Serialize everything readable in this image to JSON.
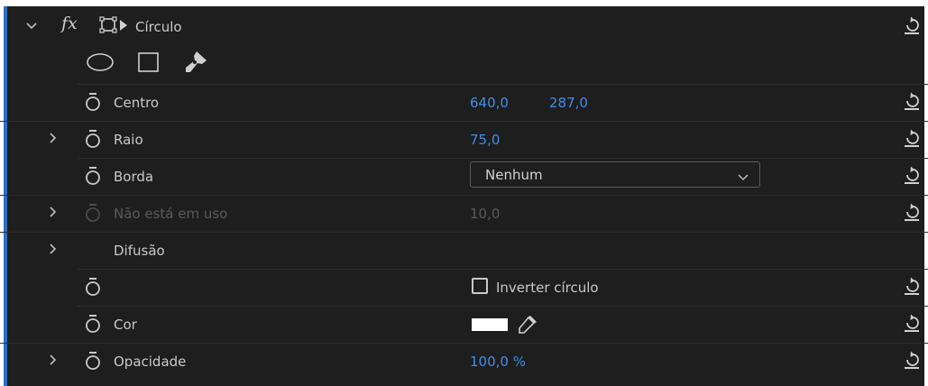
{
  "effect": {
    "title": "Círculo",
    "fx_label": "fx"
  },
  "colors": {
    "panel_bg": "#1e1e1e",
    "accent": "#2f6fbf",
    "value_blue": "#3f8ee8",
    "text": "#c9c9c9",
    "disabled": "#5a5a5a"
  },
  "tools": [
    "ellipse-tool",
    "rectangle-tool",
    "pen-tool"
  ],
  "properties": {
    "centro": {
      "label": "Centro",
      "x": "640,0",
      "y": "287,0"
    },
    "raio": {
      "label": "Raio",
      "value": "75,0"
    },
    "borda": {
      "label": "Borda",
      "selected": "Nenhum"
    },
    "nao_uso": {
      "label": "Não está em uso",
      "value": "10,0"
    },
    "difusao": {
      "label": "Difusão"
    },
    "inverter": {
      "label": "Inverter círculo"
    },
    "cor": {
      "label": "Cor",
      "value": "#ffffff"
    },
    "opacidade": {
      "label": "Opacidade",
      "value": "100,0 %"
    }
  }
}
